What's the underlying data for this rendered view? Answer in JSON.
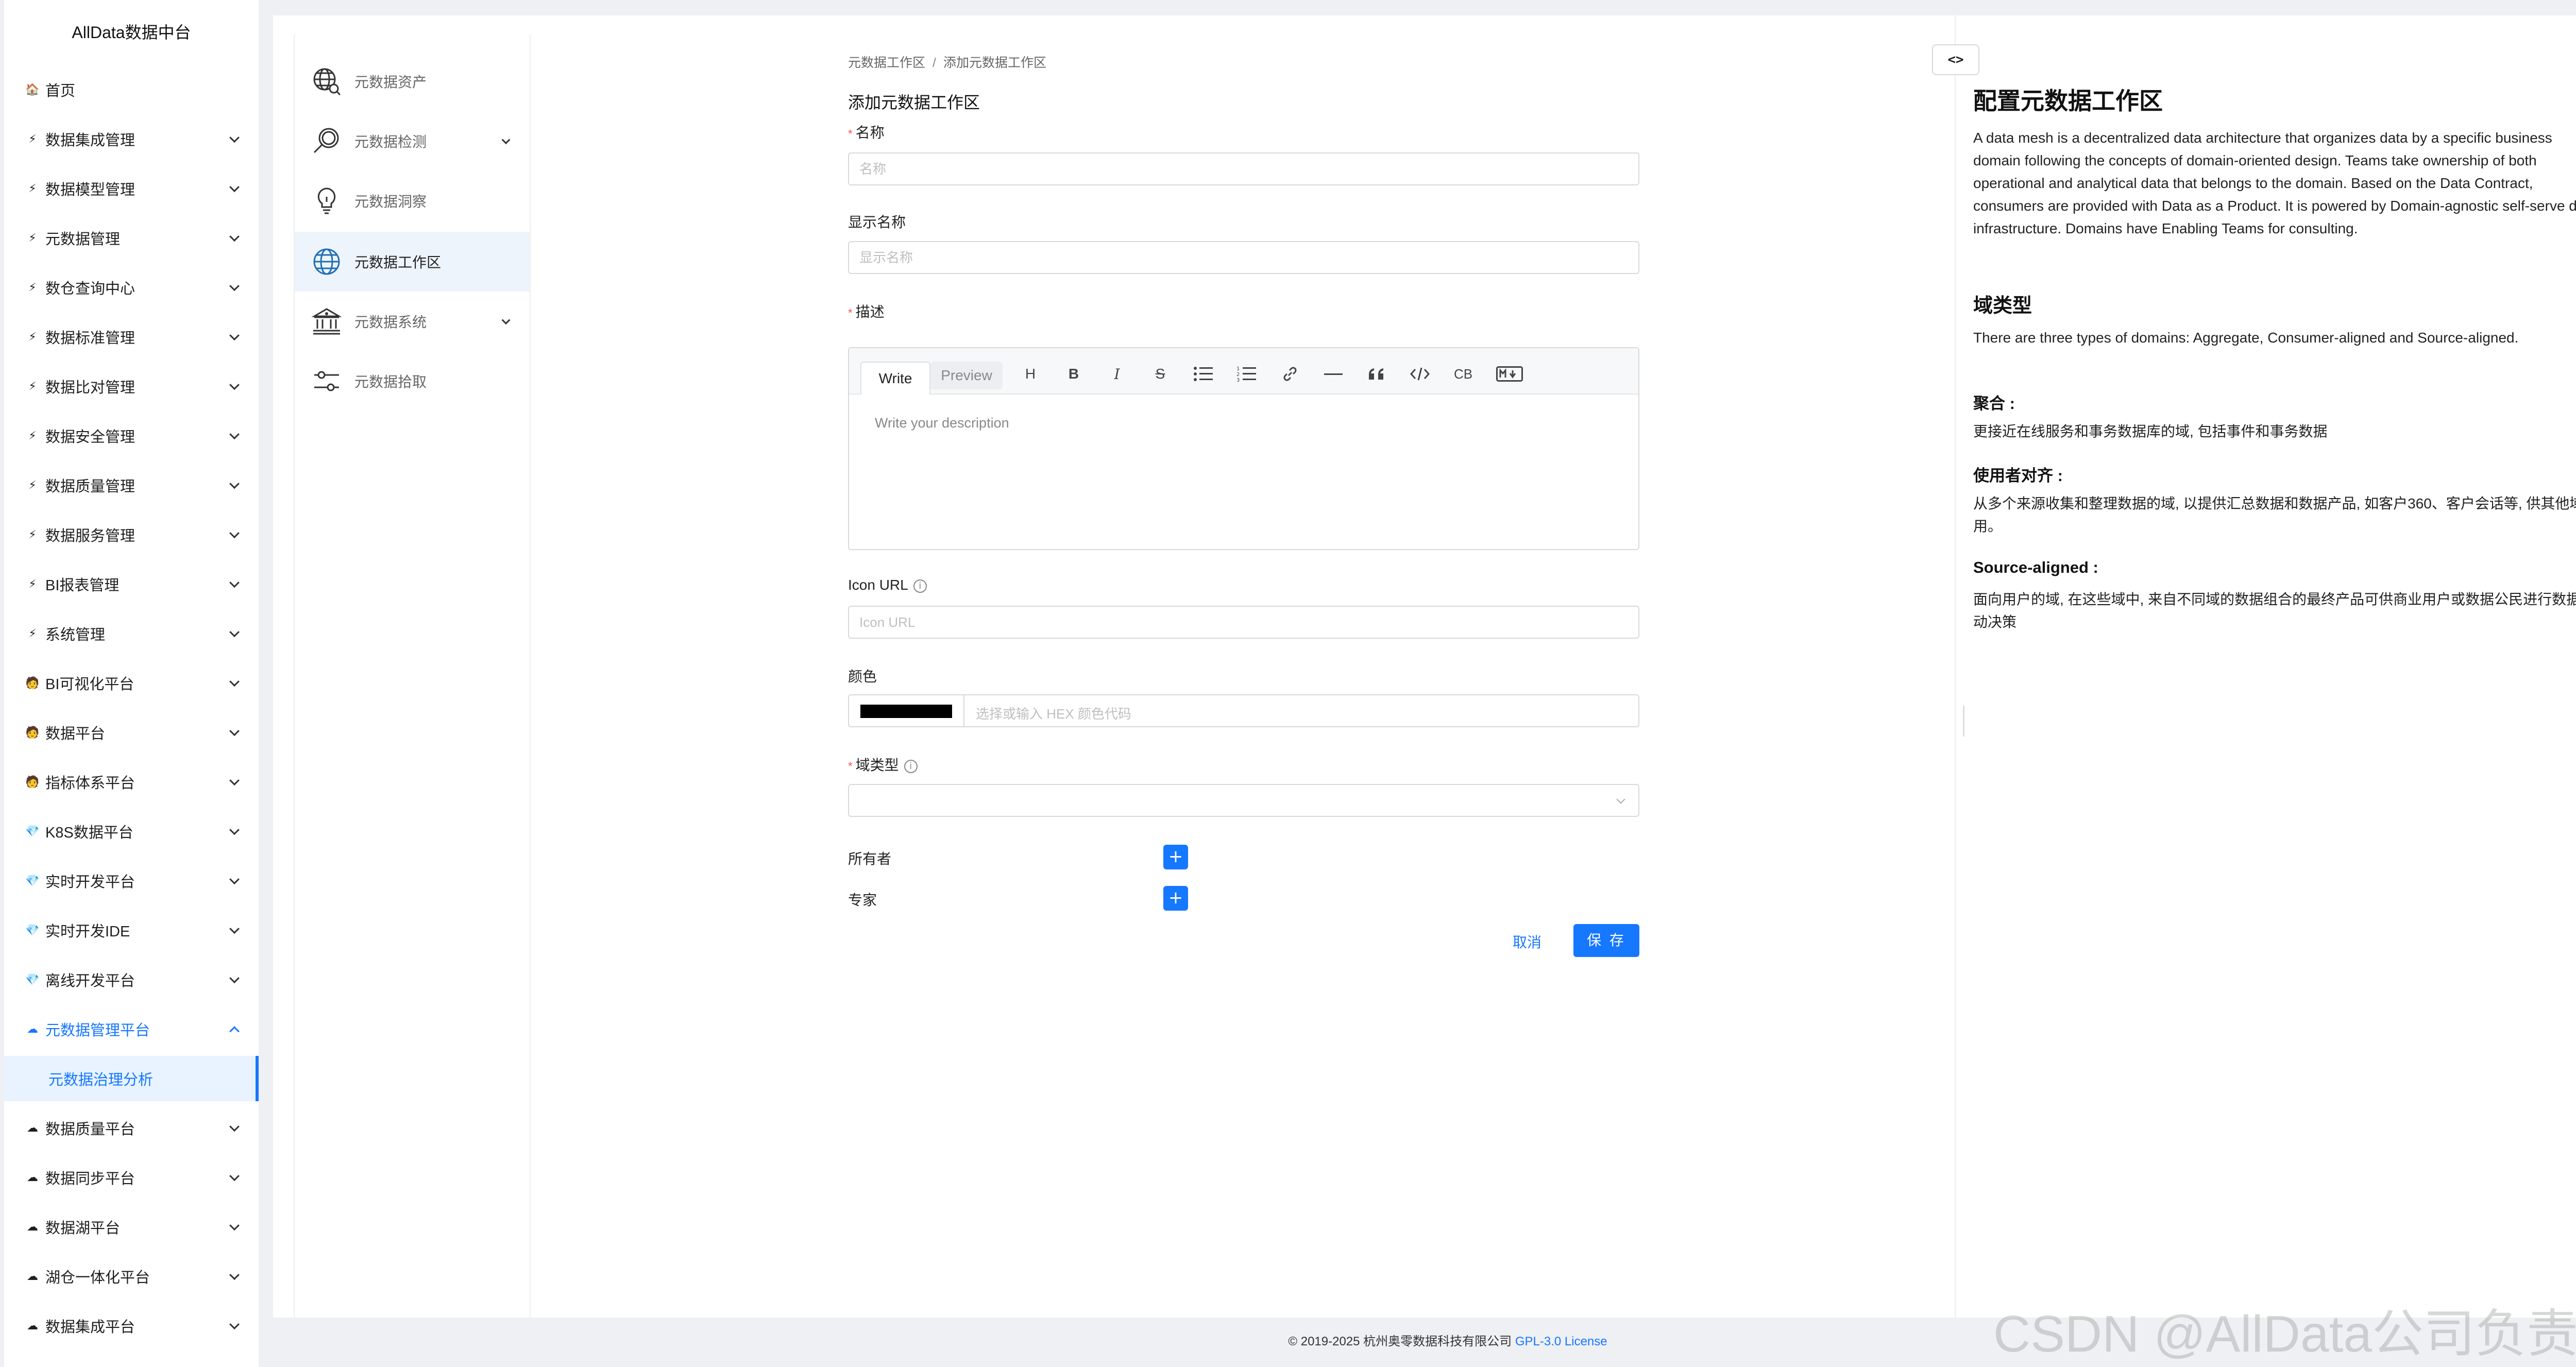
{
  "app": {
    "brand": "AllData数据中台"
  },
  "sidebar": {
    "items": [
      {
        "label": "首页",
        "icon": "home-icon",
        "glyph": "🏠",
        "expandable": false
      },
      {
        "label": "数据集成管理",
        "icon": "lightning-icon",
        "glyph": "⚡",
        "expandable": true
      },
      {
        "label": "数据模型管理",
        "icon": "lightning-icon",
        "glyph": "⚡",
        "expandable": true
      },
      {
        "label": "元数据管理",
        "icon": "lightning-icon",
        "glyph": "⚡",
        "expandable": true
      },
      {
        "label": "数仓查询中心",
        "icon": "lightning-icon",
        "glyph": "⚡",
        "expandable": true
      },
      {
        "label": "数据标准管理",
        "icon": "lightning-icon",
        "glyph": "⚡",
        "expandable": true
      },
      {
        "label": "数据比对管理",
        "icon": "lightning-icon",
        "glyph": "⚡",
        "expandable": true
      },
      {
        "label": "数据安全管理",
        "icon": "lightning-icon",
        "glyph": "⚡",
        "expandable": true
      },
      {
        "label": "数据质量管理",
        "icon": "lightning-icon",
        "glyph": "⚡",
        "expandable": true
      },
      {
        "label": "数据服务管理",
        "icon": "lightning-icon",
        "glyph": "⚡",
        "expandable": true
      },
      {
        "label": "BI报表管理",
        "icon": "lightning-icon",
        "glyph": "⚡",
        "expandable": true
      },
      {
        "label": "系统管理",
        "icon": "lightning-icon",
        "glyph": "⚡",
        "expandable": true
      },
      {
        "label": "BI可视化平台",
        "icon": "person-icon",
        "glyph": "🧑",
        "expandable": true
      },
      {
        "label": "数据平台",
        "icon": "person-icon",
        "glyph": "🧑",
        "expandable": true
      },
      {
        "label": "指标体系平台",
        "icon": "person-icon",
        "glyph": "🧑",
        "expandable": true
      },
      {
        "label": "K8S数据平台",
        "icon": "gem-icon",
        "glyph": "💎",
        "expandable": true
      },
      {
        "label": "实时开发平台",
        "icon": "gem-icon",
        "glyph": "💎",
        "expandable": true
      },
      {
        "label": "实时开发IDE",
        "icon": "gem-icon",
        "glyph": "💎",
        "expandable": true
      },
      {
        "label": "离线开发平台",
        "icon": "gem-icon",
        "glyph": "💎",
        "expandable": true
      },
      {
        "label": "元数据管理平台",
        "icon": "cloud-icon",
        "glyph": "☁",
        "expandable": true,
        "open": true
      },
      {
        "label": "元数据治理分析",
        "icon": "",
        "glyph": "",
        "expandable": false,
        "sub": true
      },
      {
        "label": "数据质量平台",
        "icon": "cloud-icon",
        "glyph": "☁",
        "expandable": true
      },
      {
        "label": "数据同步平台",
        "icon": "cloud-icon",
        "glyph": "☁",
        "expandable": true
      },
      {
        "label": "数据湖平台",
        "icon": "cloud-icon",
        "glyph": "☁",
        "expandable": true
      },
      {
        "label": "湖仓一体化平台",
        "icon": "cloud-icon",
        "glyph": "☁",
        "expandable": true
      },
      {
        "label": "数据集成平台",
        "icon": "cloud-icon",
        "glyph": "☁",
        "expandable": true
      }
    ]
  },
  "subnav": {
    "items": [
      {
        "label": "元数据资产",
        "icon": "globe-search-icon",
        "expandable": false
      },
      {
        "label": "元数据检测",
        "icon": "magnifier-icon",
        "expandable": true
      },
      {
        "label": "元数据洞察",
        "icon": "lightbulb-icon",
        "expandable": false
      },
      {
        "label": "元数据工作区",
        "icon": "globe-icon",
        "expandable": false,
        "active": true
      },
      {
        "label": "元数据系统",
        "icon": "bank-icon",
        "expandable": true
      },
      {
        "label": "元数据拾取",
        "icon": "sliders-icon",
        "expandable": false
      }
    ]
  },
  "breadcrumb": {
    "parent": "元数据工作区",
    "separator": "/",
    "current": "添加元数据工作区"
  },
  "form": {
    "title": "添加元数据工作区",
    "name": {
      "label": "名称",
      "placeholder": "名称"
    },
    "display_name": {
      "label": "显示名称",
      "placeholder": "显示名称"
    },
    "description": {
      "label": "描述",
      "write_tab": "Write",
      "preview_tab": "Preview",
      "placeholder": "Write your description"
    },
    "icon_url": {
      "label": "Icon URL",
      "placeholder": "Icon URL"
    },
    "color": {
      "label": "颜色",
      "value": "#000000",
      "placeholder": "选择或输入 HEX 颜色代码"
    },
    "domain_type": {
      "label": "域类型",
      "value": ""
    },
    "owner": {
      "label": "所有者"
    },
    "expert": {
      "label": "专家"
    },
    "cancel": "取消",
    "save": "保 存"
  },
  "toolbar": {
    "heading": "H",
    "bold": "B",
    "italic": "I",
    "strike": "S",
    "codeblock": "CB"
  },
  "panel": {
    "toggle": "<>",
    "title": "配置元数据工作区",
    "intro": "A data mesh is a decentralized data architecture that organizes data by a specific business domain following the concepts of domain-oriented design. Teams take ownership of both operational and analytical data that belongs to the domain. Based on the Data Contract, consumers are provided with Data as a Product. It is powered by Domain-agnostic self-serve data infrastructure. Domains have Enabling Teams for consulting.",
    "domain_type_heading": "域类型",
    "domain_type_text": "There are three types of domains: Aggregate, Consumer-aligned and Source-aligned.",
    "aggregate_heading": "聚合 :",
    "aggregate_text": "更接近在线服务和事务数据库的域, 包括事件和事务数据",
    "consumer_heading": "使用者对齐 :",
    "consumer_text": "从多个来源收集和整理数据的域, 以提供汇总数据和数据产品, 如客户360、客户会话等, 供其他域使用。",
    "source_heading": "Source-aligned :",
    "source_text": "面向用户的域, 在这些域中, 来自不同域的数据组合的最终产品可供商业用户或数据公民进行数据驱动决策"
  },
  "footer": {
    "copyright": "© 2019-2025 杭州奥零数据科技有限公司",
    "license": "GPL-3.0 License"
  },
  "watermark": "CSDN @AllData公司负责人",
  "colors": {
    "accent": "#1677ff",
    "required": "#ff4d4f"
  }
}
